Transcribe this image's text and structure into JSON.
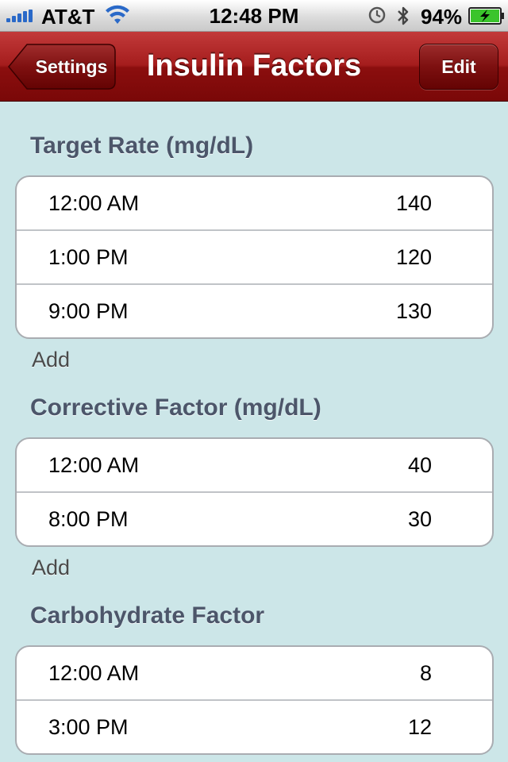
{
  "status_bar": {
    "carrier": "AT&T",
    "time": "12:48 PM",
    "battery_percent": "94%",
    "signal_bars": 5
  },
  "nav": {
    "back_label": "Settings",
    "title": "Insulin Factors",
    "edit_label": "Edit"
  },
  "sections": [
    {
      "header": "Target Rate (mg/dL)",
      "rows": [
        {
          "time": "12:00 AM",
          "value": "140"
        },
        {
          "time": "1:00 PM",
          "value": "120"
        },
        {
          "time": "9:00 PM",
          "value": "130"
        }
      ],
      "add_label": "Add"
    },
    {
      "header": "Corrective Factor (mg/dL)",
      "rows": [
        {
          "time": "12:00 AM",
          "value": "40"
        },
        {
          "time": "8:00 PM",
          "value": "30"
        }
      ],
      "add_label": "Add"
    },
    {
      "header": "Carbohydrate Factor",
      "rows": [
        {
          "time": "12:00 AM",
          "value": "8"
        },
        {
          "time": "3:00 PM",
          "value": "12"
        }
      ]
    }
  ],
  "colors": {
    "nav_red": "#9a1414",
    "background": "#cce6e8",
    "header_text": "#4c566a",
    "signal_blue": "#2a69c8",
    "battery_green": "#3ac42c"
  }
}
